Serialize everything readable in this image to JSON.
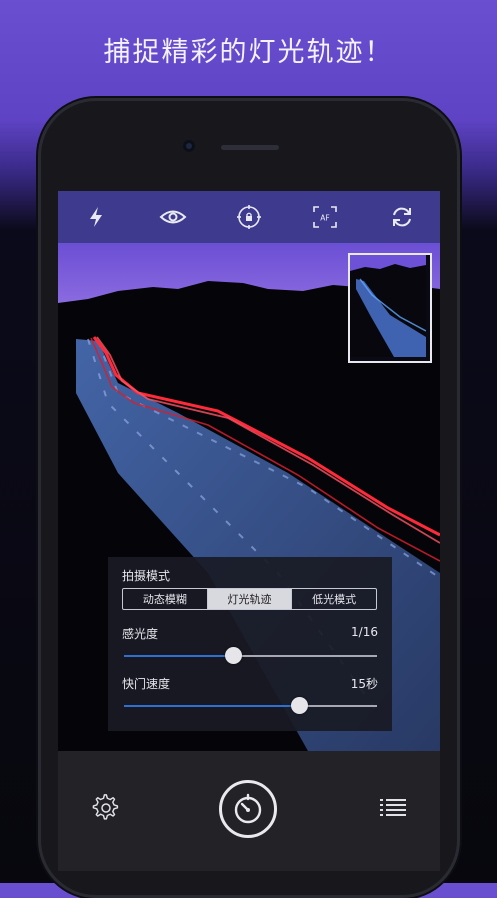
{
  "headline": "捕捉精彩的灯光轨迹！",
  "toolbar": {
    "icons": [
      "flash-icon",
      "eye-icon",
      "focus-lock-icon",
      "af-icon",
      "switch-camera-icon"
    ],
    "af_label": "AF"
  },
  "panel": {
    "mode_title": "拍摄模式",
    "modes": [
      "动态模糊",
      "灯光轨迹",
      "低光模式"
    ],
    "selected_mode": "灯光轨迹",
    "iso_label": "感光度",
    "iso_value": "1/16",
    "iso_level": 0.43,
    "shutter_label": "快门速度",
    "shutter_value": "15秒",
    "shutter_level": 0.69
  },
  "colors": {
    "background_top": "#6a4fd0",
    "toolbar": "#3e3a8e",
    "slider_fill": "#2f6fd1",
    "light_trail": "#ff2a3a",
    "road": "#3d5c9c"
  }
}
